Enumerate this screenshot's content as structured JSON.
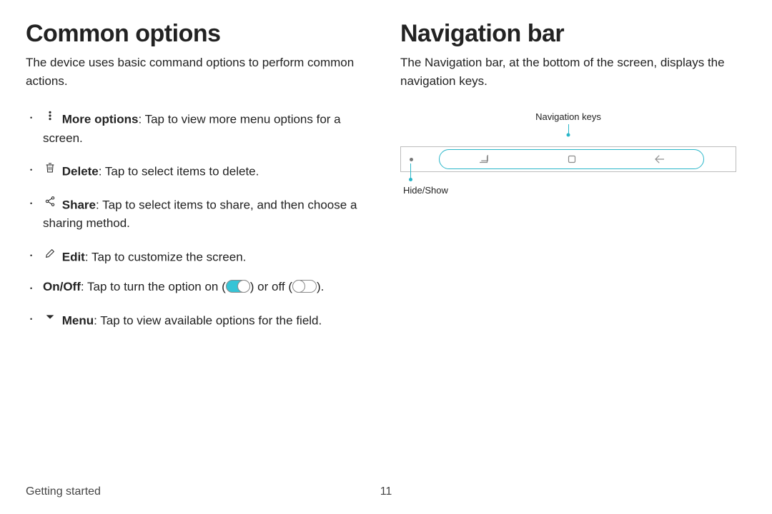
{
  "left": {
    "heading": "Common options",
    "intro": "The device uses basic command options to perform common actions.",
    "items": {
      "more": {
        "label": "More options",
        "desc": ": Tap to view more menu options for a screen."
      },
      "delete": {
        "label": "Delete",
        "desc": ": Tap to select items to delete."
      },
      "share": {
        "label": "Share",
        "desc": ": Tap to select items to share, and then choose a sharing method."
      },
      "edit": {
        "label": "Edit",
        "desc": ": Tap to customize the screen."
      },
      "onoff": {
        "label": "On/Off",
        "pre": ": Tap to turn the option on (",
        "mid": ") or off (",
        "post": ")."
      },
      "menu": {
        "label": "Menu",
        "desc": ": Tap to view available options for the field."
      }
    }
  },
  "right": {
    "heading": "Navigation bar",
    "intro": "The Navigation bar, at the bottom of the screen, displays the navigation keys.",
    "labels": {
      "navkeys": "Navigation keys",
      "hideshow": "Hide/Show"
    }
  },
  "footer": {
    "section": "Getting started",
    "page": "11"
  }
}
